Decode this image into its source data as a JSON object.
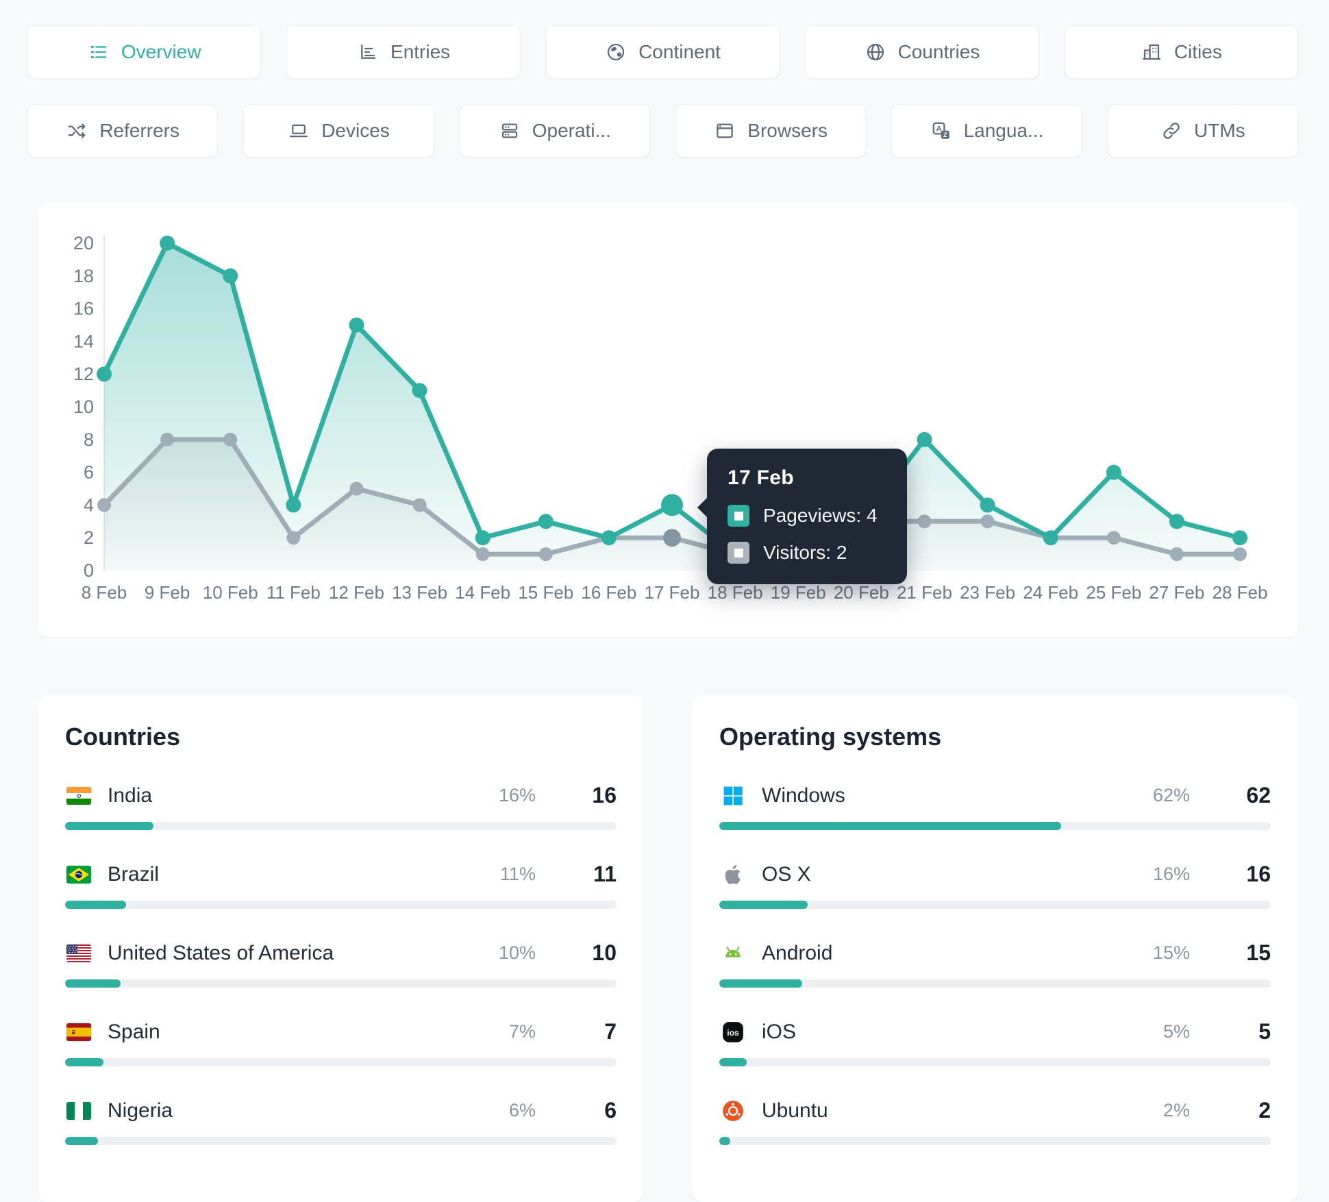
{
  "colors": {
    "accent": "#2fb0a1",
    "muted_series": "#9fadb6",
    "tooltip_bg": "#1f2935",
    "windows_blue": "#00adef",
    "apple_gray": "#8e949e",
    "android_green": "#7cc23f",
    "ios_black": "#0c0d10",
    "ubuntu_orange": "#e95420"
  },
  "nav": {
    "row1": [
      {
        "label": "Overview",
        "icon": "list-icon",
        "active": true
      },
      {
        "label": "Entries",
        "icon": "entries-chart-icon",
        "active": false
      },
      {
        "label": "Continent",
        "icon": "continent-globe-icon",
        "active": false
      },
      {
        "label": "Countries",
        "icon": "globe-icon",
        "active": false
      },
      {
        "label": "Cities",
        "icon": "city-buildings-icon",
        "active": false
      }
    ],
    "row2": [
      {
        "label": "Referrers",
        "icon": "shuffle-icon",
        "active": false
      },
      {
        "label": "Devices",
        "icon": "laptop-icon",
        "active": false
      },
      {
        "label": "Operati...",
        "icon": "server-icon",
        "active": false
      },
      {
        "label": "Browsers",
        "icon": "browser-window-icon",
        "active": false
      },
      {
        "label": "Langua...",
        "icon": "translate-icon",
        "active": false
      },
      {
        "label": "UTMs",
        "icon": "link-icon",
        "active": false
      }
    ]
  },
  "chart_data": {
    "type": "line",
    "x": [
      "8 Feb",
      "9 Feb",
      "10 Feb",
      "11 Feb",
      "12 Feb",
      "13 Feb",
      "14 Feb",
      "15 Feb",
      "16 Feb",
      "17 Feb",
      "18 Feb",
      "19 Feb",
      "20 Feb",
      "21 Feb",
      "23 Feb",
      "24 Feb",
      "25 Feb",
      "27 Feb",
      "28 Feb"
    ],
    "series": [
      {
        "name": "Pageviews",
        "color": "#2fb0a1",
        "fill": "teal",
        "values": [
          12,
          20,
          18,
          4,
          15,
          11,
          2,
          3,
          2,
          4,
          1,
          2,
          3,
          8,
          4,
          2,
          6,
          3,
          2
        ]
      },
      {
        "name": "Visitors",
        "color": "#9fadb6",
        "fill": "gray",
        "values": [
          4,
          8,
          8,
          2,
          5,
          4,
          1,
          1,
          2,
          2,
          1,
          1,
          3,
          3,
          3,
          2,
          2,
          1,
          1
        ]
      }
    ],
    "ylim": [
      0,
      20
    ],
    "yticks": [
      0,
      2,
      4,
      6,
      8,
      10,
      12,
      14,
      16,
      18,
      20
    ],
    "grid": false,
    "legend_position": "none",
    "highlight_index": 9
  },
  "tooltip": {
    "date": "17 Feb",
    "rows": [
      {
        "label": "Pageviews",
        "value": "4",
        "color": "#2fb0a1"
      },
      {
        "label": "Visitors",
        "value": "2",
        "color": "#aab3bc"
      }
    ]
  },
  "panels": [
    {
      "title": "Countries",
      "items": [
        {
          "label": "India",
          "icon": "india-flag-icon",
          "percent": "16%",
          "value": "16",
          "pct": 16
        },
        {
          "label": "Brazil",
          "icon": "brazil-flag-icon",
          "percent": "11%",
          "value": "11",
          "pct": 11
        },
        {
          "label": "United States of America",
          "icon": "usa-flag-icon",
          "percent": "10%",
          "value": "10",
          "pct": 10
        },
        {
          "label": "Spain",
          "icon": "spain-flag-icon",
          "percent": "7%",
          "value": "7",
          "pct": 7
        },
        {
          "label": "Nigeria",
          "icon": "nigeria-flag-icon",
          "percent": "6%",
          "value": "6",
          "pct": 6
        }
      ]
    },
    {
      "title": "Operating systems",
      "items": [
        {
          "label": "Windows",
          "icon": "windows-icon",
          "percent": "62%",
          "value": "62",
          "pct": 62
        },
        {
          "label": "OS X",
          "icon": "apple-icon",
          "percent": "16%",
          "value": "16",
          "pct": 16
        },
        {
          "label": "Android",
          "icon": "android-icon",
          "percent": "15%",
          "value": "15",
          "pct": 15
        },
        {
          "label": "iOS",
          "icon": "ios-icon",
          "percent": "5%",
          "value": "5",
          "pct": 5
        },
        {
          "label": "Ubuntu",
          "icon": "ubuntu-icon",
          "percent": "2%",
          "value": "2",
          "pct": 2
        }
      ]
    }
  ]
}
